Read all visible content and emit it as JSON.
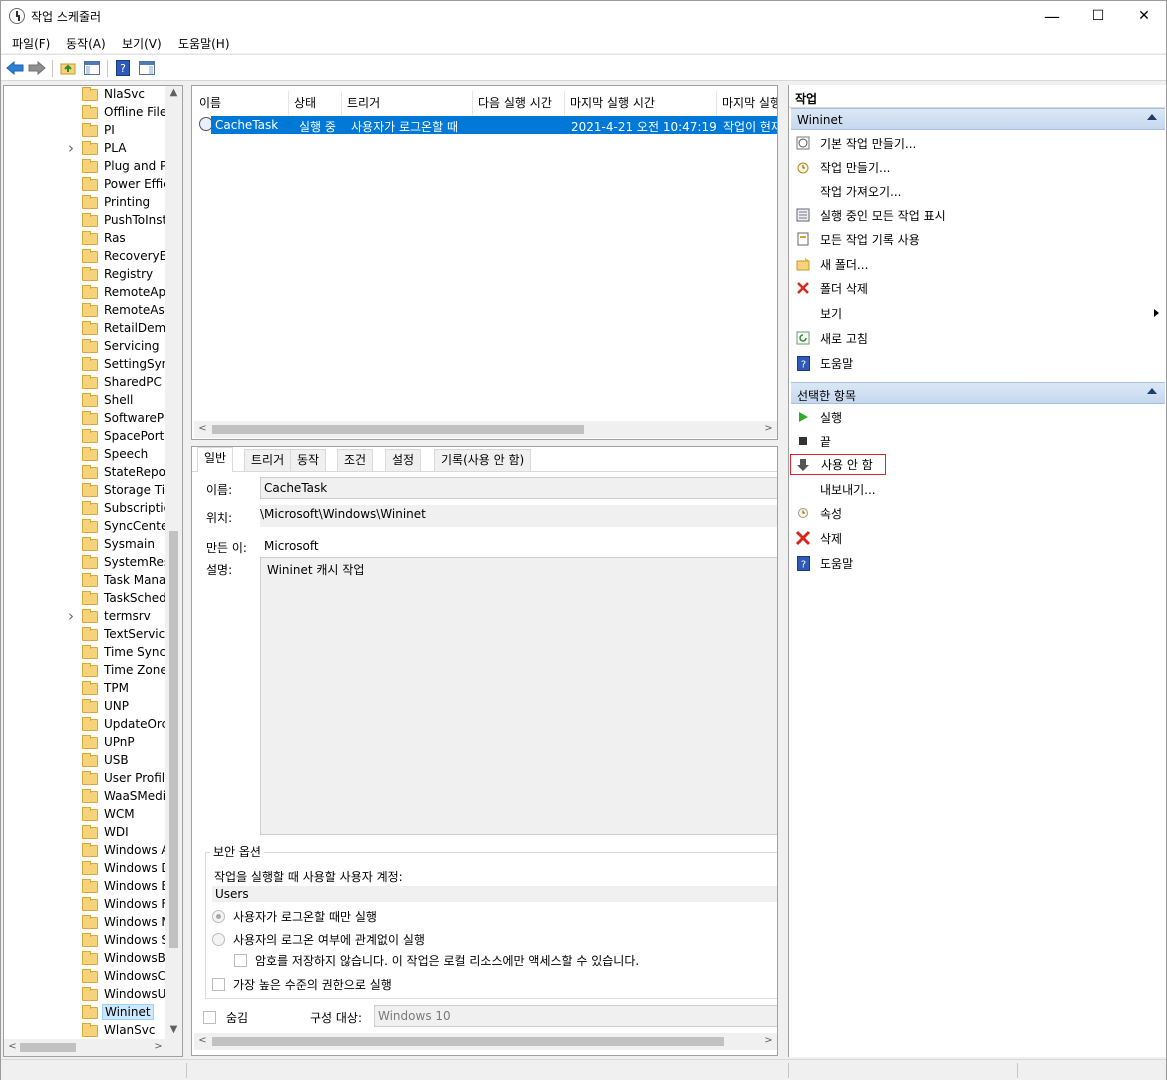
{
  "window": {
    "title": "작업 스케줄러",
    "minimize": "—",
    "maximize": "☐",
    "close": "✕"
  },
  "menu": [
    "파일(F)",
    "동작(A)",
    "보기(V)",
    "도움말(H)"
  ],
  "tree": {
    "items": [
      {
        "label": "NlaSvc",
        "expandable": false
      },
      {
        "label": "Offline Files",
        "expandable": false
      },
      {
        "label": "PI",
        "expandable": false
      },
      {
        "label": "PLA",
        "expandable": true
      },
      {
        "label": "Plug and P",
        "expandable": false
      },
      {
        "label": "Power Effic",
        "expandable": false
      },
      {
        "label": "Printing",
        "expandable": false
      },
      {
        "label": "PushToInsta",
        "expandable": false
      },
      {
        "label": "Ras",
        "expandable": false
      },
      {
        "label": "RecoveryEn",
        "expandable": false
      },
      {
        "label": "Registry",
        "expandable": false
      },
      {
        "label": "RemoteApp",
        "expandable": false
      },
      {
        "label": "RemoteAss",
        "expandable": false
      },
      {
        "label": "RetailDemo",
        "expandable": false
      },
      {
        "label": "Servicing",
        "expandable": false
      },
      {
        "label": "SettingSync",
        "expandable": false
      },
      {
        "label": "SharedPC",
        "expandable": false
      },
      {
        "label": "Shell",
        "expandable": false
      },
      {
        "label": "SoftwarePro",
        "expandable": false
      },
      {
        "label": "SpacePort",
        "expandable": false
      },
      {
        "label": "Speech",
        "expandable": false
      },
      {
        "label": "StateRepos",
        "expandable": false
      },
      {
        "label": "Storage Tie",
        "expandable": false
      },
      {
        "label": "Subscriptio",
        "expandable": false
      },
      {
        "label": "SyncCenter",
        "expandable": false
      },
      {
        "label": "Sysmain",
        "expandable": false
      },
      {
        "label": "SystemRest",
        "expandable": false
      },
      {
        "label": "Task Manag",
        "expandable": false
      },
      {
        "label": "TaskSchedu",
        "expandable": false
      },
      {
        "label": "termsrv",
        "expandable": true
      },
      {
        "label": "TextService",
        "expandable": false
      },
      {
        "label": "Time Synch",
        "expandable": false
      },
      {
        "label": "Time Zone",
        "expandable": false
      },
      {
        "label": "TPM",
        "expandable": false
      },
      {
        "label": "UNP",
        "expandable": false
      },
      {
        "label": "UpdateOrch",
        "expandable": false
      },
      {
        "label": "UPnP",
        "expandable": false
      },
      {
        "label": "USB",
        "expandable": false
      },
      {
        "label": "User Profile",
        "expandable": false
      },
      {
        "label": "WaaSMedic",
        "expandable": false
      },
      {
        "label": "WCM",
        "expandable": false
      },
      {
        "label": "WDI",
        "expandable": false
      },
      {
        "label": "Windows A",
        "expandable": false
      },
      {
        "label": "Windows D",
        "expandable": false
      },
      {
        "label": "Windows E",
        "expandable": false
      },
      {
        "label": "Windows F",
        "expandable": false
      },
      {
        "label": "Windows M",
        "expandable": false
      },
      {
        "label": "Windows S",
        "expandable": false
      },
      {
        "label": "WindowsBa",
        "expandable": false
      },
      {
        "label": "WindowsCo",
        "expandable": false
      },
      {
        "label": "WindowsUp",
        "expandable": false
      },
      {
        "label": "Wininet",
        "expandable": false,
        "selected": true
      },
      {
        "label": "WlanSvc",
        "expandable": false
      }
    ]
  },
  "tasklist": {
    "columns": [
      "이름",
      "상태",
      "트리거",
      "다음 실행 시간",
      "마지막 실행 시간",
      "마지막 실행"
    ],
    "row": {
      "name": "CacheTask",
      "status": "실행 중",
      "trigger": "사용자가 로그온할 때",
      "next": "",
      "last": "2021-4-21 오전 10:47:19",
      "result": "작업이 현재"
    }
  },
  "detail": {
    "tabs": [
      "일반",
      "트리거",
      "동작",
      "조건",
      "설정",
      "기록(사용 안 함)"
    ],
    "name_label": "이름:",
    "name_value": "CacheTask",
    "location_label": "위치:",
    "location_value": "\\Microsoft\\Windows\\Wininet",
    "author_label": "만든 이:",
    "author_value": "Microsoft",
    "desc_label": "설명:",
    "desc_value": "Wininet 캐시 작업",
    "security_title": "보안 옵션",
    "account_label": "작업을 실행할 때 사용할 사용자 계정:",
    "account_value": "Users",
    "radio1": "사용자가 로그온할 때만 실행",
    "radio2": "사용자의 로그온 여부에 관계없이 실행",
    "nopass": "암호를 저장하지 않습니다. 이 작업은 로컬 리소스에만 액세스할 수 있습니다.",
    "highest": "가장 높은 수준의 권한으로 실행",
    "hidden": "숨김",
    "config_label": "구성 대상:",
    "config_value": "Windows 10"
  },
  "actions": {
    "title": "작업",
    "section1": "Wininet",
    "items1": [
      {
        "label": "기본 작업 만들기...",
        "icon": "basic-task-icon"
      },
      {
        "label": "작업 만들기...",
        "icon": "create-task-icon"
      },
      {
        "label": "작업 가져오기...",
        "icon": ""
      },
      {
        "label": "실행 중인 모든 작업 표시",
        "icon": "running-tasks-icon"
      },
      {
        "label": "모든 작업 기록 사용",
        "icon": "history-icon"
      },
      {
        "label": "새 폴더...",
        "icon": "new-folder-icon"
      },
      {
        "label": "폴더 삭제",
        "icon": "delete-folder-icon"
      },
      {
        "label": "보기",
        "icon": ""
      },
      {
        "label": "새로 고침",
        "icon": "refresh-icon"
      },
      {
        "label": "도움말",
        "icon": "help-icon"
      }
    ],
    "section2": "선택한 항목",
    "items2": [
      {
        "label": "실행",
        "icon": "run-icon"
      },
      {
        "label": "끝",
        "icon": "end-icon"
      },
      {
        "label": "사용 안 함",
        "icon": "disable-icon"
      },
      {
        "label": "내보내기...",
        "icon": ""
      },
      {
        "label": "속성",
        "icon": "properties-icon"
      },
      {
        "label": "삭제",
        "icon": "delete-icon"
      },
      {
        "label": "도움말",
        "icon": "help-icon"
      }
    ]
  },
  "colors": {
    "selection": "#0078d7",
    "section_header": "#c6d8ee",
    "highlight_box": "#e3242b"
  }
}
